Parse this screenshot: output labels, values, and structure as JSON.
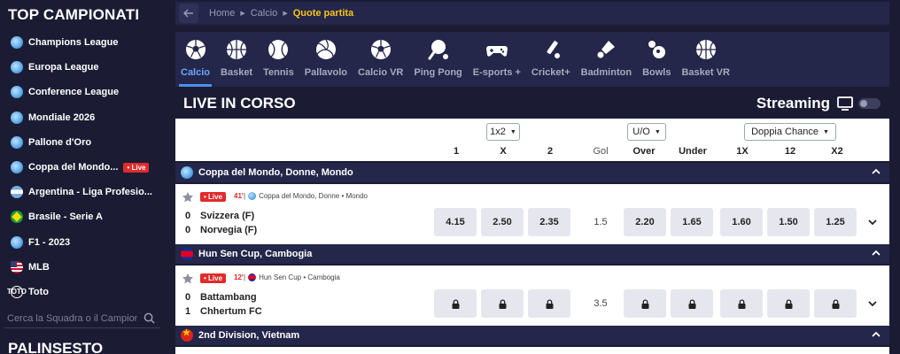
{
  "sidebar": {
    "title": "TOP CAMPIONATI",
    "items": [
      {
        "label": "Champions League",
        "flag": "globe"
      },
      {
        "label": "Europa League",
        "flag": "globe"
      },
      {
        "label": "Conference League",
        "flag": "globe"
      },
      {
        "label": "Mondiale 2026",
        "flag": "globe"
      },
      {
        "label": "Pallone d'Oro",
        "flag": "globe"
      },
      {
        "label": "Coppa del Mondo...",
        "flag": "globe",
        "badge": "Live"
      },
      {
        "label": "Argentina - Liga Profesio...",
        "flag": "arg"
      },
      {
        "label": "Brasile - Serie A",
        "flag": "bra"
      },
      {
        "label": "F1 - 2023",
        "flag": "globe"
      },
      {
        "label": "MLB",
        "flag": "usa"
      },
      {
        "label": "Toto",
        "flag": "toto"
      }
    ],
    "search_placeholder": "Cerca la Squadra o il Campionato",
    "section_title": "PALINSESTO"
  },
  "breadcrumb": {
    "home": "Home",
    "sport": "Calcio",
    "current": "Quote partita"
  },
  "sports": [
    {
      "label": "Calcio",
      "icon": "soccer-ball-icon",
      "active": true
    },
    {
      "label": "Basket",
      "icon": "basketball-icon"
    },
    {
      "label": "Tennis",
      "icon": "tennis-ball-icon"
    },
    {
      "label": "Pallavolo",
      "icon": "volleyball-icon"
    },
    {
      "label": "Calcio VR",
      "icon": "soccer-vr-icon"
    },
    {
      "label": "Ping Pong",
      "icon": "ping-pong-icon"
    },
    {
      "label": "E-sports +",
      "icon": "gamepad-icon"
    },
    {
      "label": "Cricket+",
      "icon": "cricket-icon"
    },
    {
      "label": "Badminton",
      "icon": "shuttlecock-icon"
    },
    {
      "label": "Bowls",
      "icon": "bowls-icon"
    },
    {
      "label": "Basket VR",
      "icon": "basketball-vr-icon"
    }
  ],
  "live": {
    "title": "LIVE IN CORSO",
    "streaming_label": "Streaming"
  },
  "markets": {
    "select1": "1x2",
    "select2": "U/O",
    "select3": "Doppia Chance",
    "cols": {
      "c1": "1",
      "cx": "X",
      "c2": "2",
      "gol": "Gol",
      "over": "Over",
      "under": "Under",
      "dc1x": "1X",
      "dc12": "12",
      "dcx2": "X2"
    }
  },
  "competitions": [
    {
      "name": "Coppa del Mondo, Donne, Mondo",
      "match": {
        "live": "Live",
        "minute": "41'",
        "sep": "|",
        "comp_name": "Coppa del Mondo, Donne",
        "comp_region": "Mondo",
        "home": {
          "score": "0",
          "name": "Svizzera (F)"
        },
        "away": {
          "score": "0",
          "name": "Norvegia (F)"
        },
        "odds": {
          "o1": "4.15",
          "ox": "2.50",
          "o2": "2.35",
          "gol": "1.5",
          "over": "2.20",
          "under": "1.65",
          "dc1x": "1.60",
          "dc12": "1.50",
          "dcx2": "1.25"
        }
      }
    },
    {
      "name": "Hun Sen Cup, Cambogia",
      "match": {
        "live": "Live",
        "minute": "12'",
        "sep": "|",
        "comp_name": "Hun Sen Cup",
        "comp_region": "Cambogia",
        "home": {
          "score": "0",
          "name": "Battambang"
        },
        "away": {
          "score": "1",
          "name": "Chhertum FC"
        },
        "gol": "3.5"
      }
    },
    {
      "name": "2nd Division, Vietnam"
    }
  ],
  "colors": {
    "background": "#1b1c33",
    "panel": "#24264a",
    "accent_yellow": "#f5c518",
    "accent_blue": "#4d8ff0",
    "live_red": "#e02b2b"
  }
}
